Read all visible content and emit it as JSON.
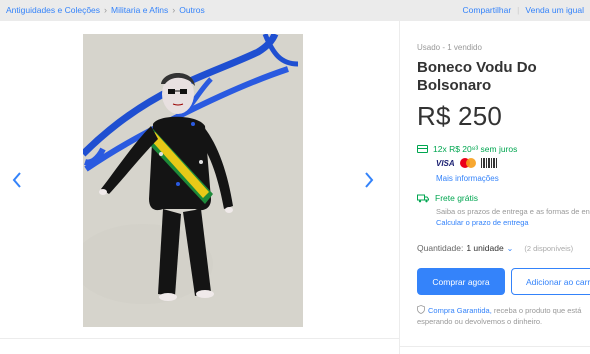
{
  "breadcrumb": {
    "items": [
      "Antiguidades e Coleções",
      "Militaria e Afins",
      "Outros"
    ],
    "separator": "›"
  },
  "top_actions": {
    "share": "Compartilhar",
    "sell": "Venda um igual"
  },
  "gallery": {
    "prev_icon": "chevron-left-icon",
    "next_icon": "chevron-right-icon"
  },
  "product": {
    "condition": "Usado  -  1 vendido",
    "title": "Boneco Vodu Do Bolsonaro",
    "price": "R$ 250",
    "installments": "12x R$ 20⁸³ sem juros",
    "payment_logos": [
      "VISA",
      "Mastercard",
      "Boleto"
    ],
    "more_info": "Mais informações",
    "shipping_title": "Frete grátis",
    "shipping_desc": "Saiba os prazos de entrega e as formas de envio.",
    "shipping_calc": "Calcular o prazo de entrega",
    "quantity_label": "Quantidade:",
    "quantity_value": "1 unidade",
    "quantity_available": "(2 disponíveis)",
    "buy_button": "Comprar agora",
    "cart_button": "Adicionar ao carrinho",
    "guarantee_link": "Compra Garantida,",
    "guarantee_text": " receba o produto que está esperando ou devolvemos o dinheiro."
  },
  "colors": {
    "accent": "#3483fa",
    "success": "#00a650",
    "ribbon": "#1f4fd1"
  }
}
